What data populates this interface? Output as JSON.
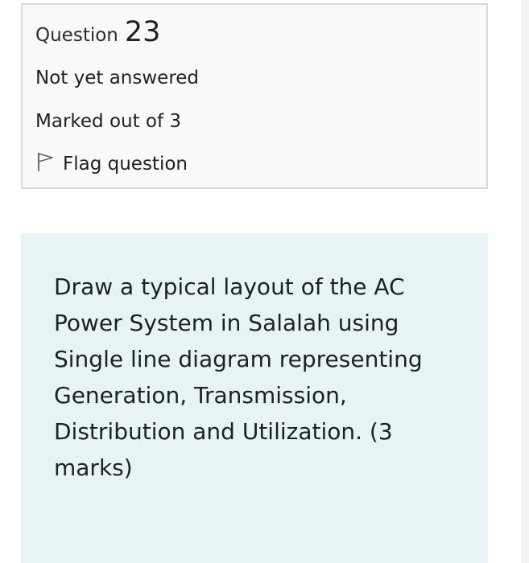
{
  "info": {
    "question_label": "Question",
    "question_number": "23",
    "state": "Not yet answered",
    "marks": "Marked out of 3",
    "flag_label": "Flag question",
    "flag_icon": "flag-outline-icon"
  },
  "question": {
    "text": "Draw a typical layout of the AC Power System in Salalah using Single line diagram representing Generation, Transmission, Distribution and Utilization. (3 marks)"
  },
  "colors": {
    "info_background": "#f8f9fa",
    "info_border": "#d7d9dc",
    "content_background": "#e7f3f5",
    "text": "#1d2125"
  }
}
